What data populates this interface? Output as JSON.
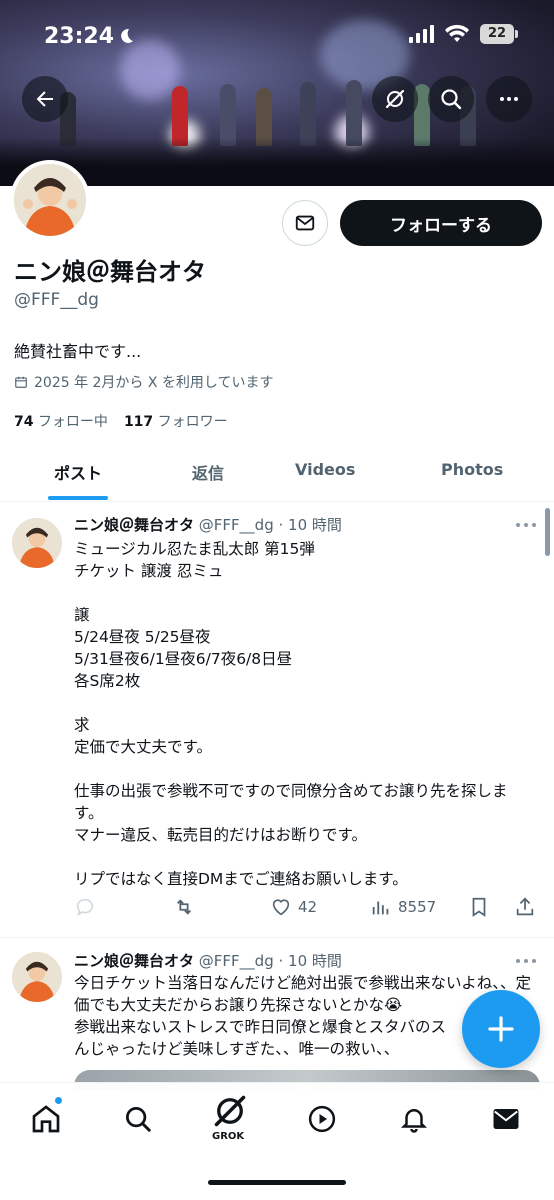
{
  "status_bar": {
    "time": "23:24",
    "battery": "22"
  },
  "profile": {
    "display_name": "ニン娘＠舞台オタ",
    "handle": "@FFF__dg",
    "bio": "絶賛社畜中です...",
    "joined": "2025 年 2月から X を利用しています",
    "following_count": "74",
    "following_label": "フォロー中",
    "followers_count": "117",
    "followers_label": "フォロワー",
    "follow_button": "フォローする"
  },
  "tabs": [
    {
      "label": "ポスト",
      "active": true
    },
    {
      "label": "返信",
      "active": false
    },
    {
      "label": "Videos",
      "active": false
    },
    {
      "label": "Photos",
      "active": false
    }
  ],
  "posts": [
    {
      "name": "ニン娘＠舞台オタ",
      "meta": "@FFF__dg · 10 時間",
      "body": "ミュージカル忍たま乱太郎 第15弾\nチケット 譲渡 忍ミュ\n\n譲\n5/24昼夜 5/25昼夜\n5/31昼夜6/1昼夜6/7夜6/8日昼\n各S席2枚\n\n求\n定価で大丈夫です。\n\n仕事の出張で参戦不可ですので同僚分含めてお譲り先を探します。\nマナー違反、転売目的だけはお断りです。\n\nリプではなく直接DMまでご連絡お願いします。",
      "likes": "42",
      "views": "8557"
    },
    {
      "name": "ニン娘＠舞台オタ",
      "meta": "@FFF__dg · 10 時間",
      "body": "今日チケット当落日なんだけど絶対出張で参戦出来ないよね、、定価でも大丈夫だからお譲り先探さないとかな😭\n参戦出来ないストレスで昨日同僚と爆食とスタバのス\nんじゃったけど美味しすぎた、、唯一の救い、、"
    }
  ],
  "bottom_nav": {
    "grok_label": "GROK"
  },
  "colors": {
    "accent": "#1d9bf0",
    "text": "#0f1419",
    "muted": "#536471"
  }
}
